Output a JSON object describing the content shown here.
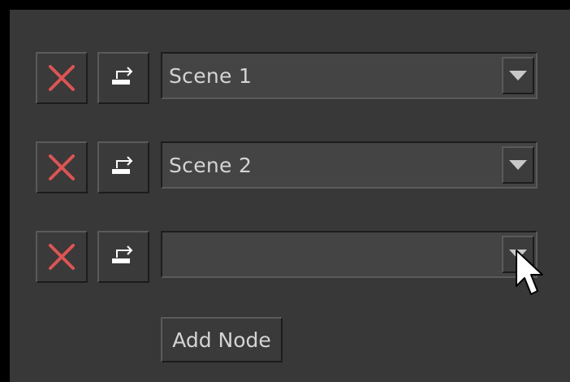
{
  "colors": {
    "panel": "#383838",
    "delete_icon": "#e05353",
    "text": "#d4d4d4"
  },
  "rows": [
    {
      "delete_icon": "close-icon",
      "swap_icon": "swap-icon",
      "value": "Scene 1"
    },
    {
      "delete_icon": "close-icon",
      "swap_icon": "swap-icon",
      "value": "Scene 2"
    },
    {
      "delete_icon": "close-icon",
      "swap_icon": "swap-icon",
      "value": ""
    }
  ],
  "add_node_label": "Add Node",
  "cursor_icon": "pointer-cursor-icon"
}
